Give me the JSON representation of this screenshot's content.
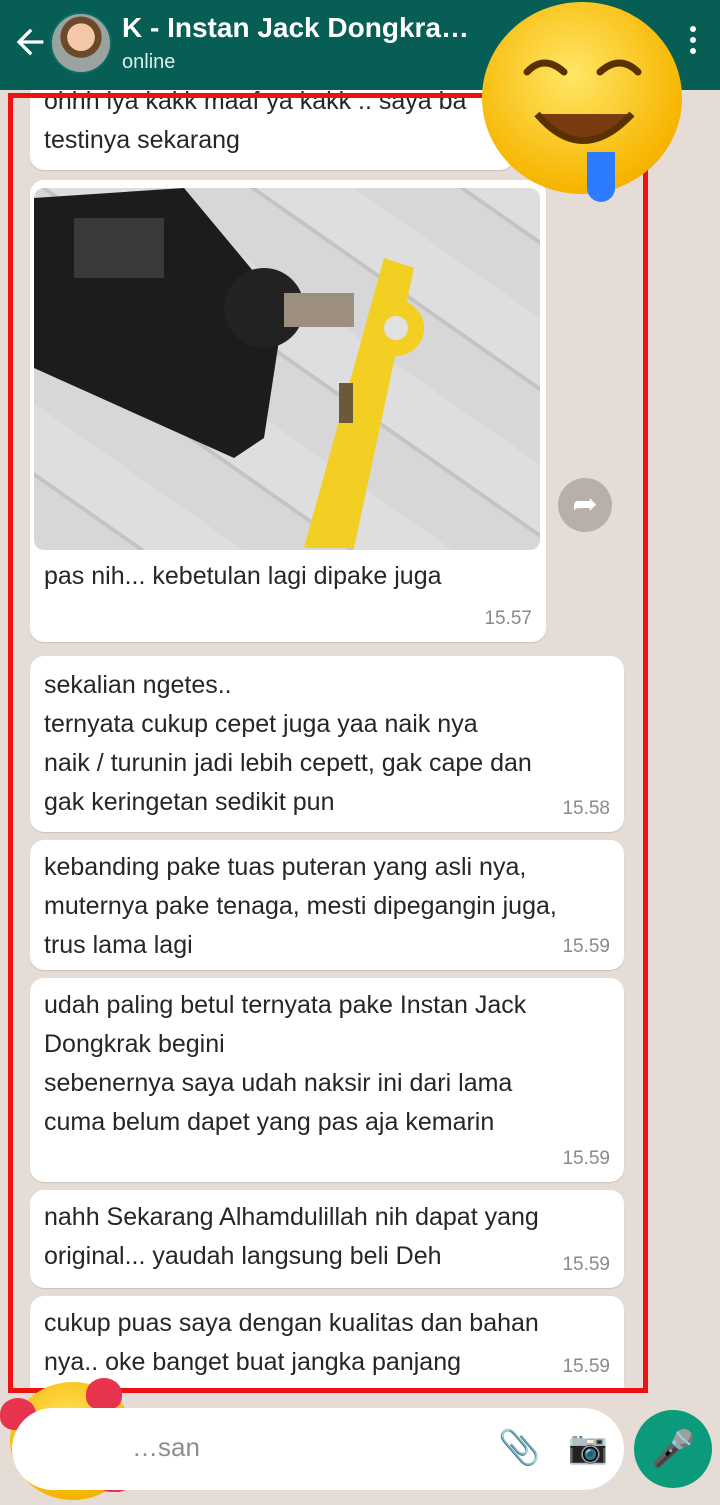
{
  "header": {
    "title": "K - Instan Jack Dongkra…",
    "status": "online"
  },
  "messages": [
    {
      "text": "ohhh iya kakk maaf ya kakk .. saya ba\ntestinya sekarang",
      "time": ""
    },
    {
      "text": "pas nih... kebetulan lagi dipake juga",
      "time": "15.57"
    },
    {
      "text": "sekalian ngetes..\nternyata cukup cepet juga yaa naik nya \nnaik / turunin jadi lebih cepett, gak cape dan\ngak keringetan sedikit pun",
      "time": "15.58"
    },
    {
      "text": "kebanding pake tuas puteran yang asli nya,\nmuternya pake tenaga, mesti dipegangin juga,\ntrus lama lagi",
      "time": "15.59"
    },
    {
      "text": "udah paling betul ternyata pake Instan Jack\nDongkrak begini\nsebenernya saya udah naksir ini dari lama\ncuma belum dapet yang pas aja kemarin",
      "time": "15.59"
    },
    {
      "text": "nahh Sekarang Alhamdulillah nih dapat yang\noriginal... yaudah langsung beli Deh",
      "time": "15.59"
    },
    {
      "text": "cukup puas saya dengan kualitas dan bahan\nnya.. oke banget buat jangka panjang",
      "time": "15.59"
    }
  ],
  "input": {
    "placeholder": "…san"
  },
  "icons": {
    "back": "arrow-left-icon",
    "menu": "more-vert-icon",
    "forward": "share-forward-icon",
    "attach": "paperclip-icon",
    "camera": "camera-icon",
    "mic": "mic-icon"
  },
  "colors": {
    "header": "#075e54",
    "chat_background": "#e5ddd5",
    "mic_button": "#0b9b7a",
    "highlight_border": "#ee1111"
  }
}
